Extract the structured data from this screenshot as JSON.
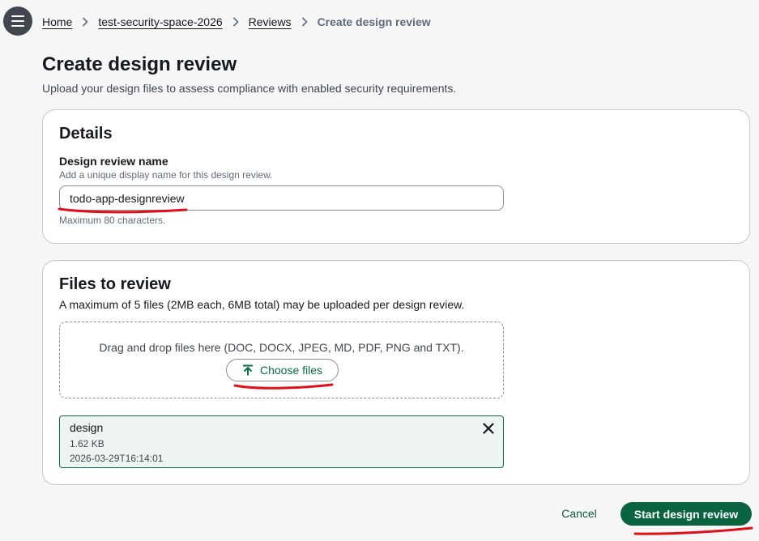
{
  "nav": {
    "menu_icon": "hamburger-menu-icon"
  },
  "breadcrumb": {
    "items": [
      "Home",
      "test-security-space-2026",
      "Reviews"
    ],
    "current": "Create design review",
    "separator_icon": "chevron-right-icon"
  },
  "page": {
    "title": "Create design review",
    "description": "Upload your design files to assess compliance with enabled security requirements."
  },
  "details": {
    "title": "Details",
    "name_label": "Design review name",
    "name_description": "Add a unique display name for this design review.",
    "name_value": "todo-app-designreview",
    "name_constraint": "Maximum 80 characters."
  },
  "files": {
    "title": "Files to review",
    "description": "A maximum of 5 files (2MB each, 6MB total) may be uploaded per design review.",
    "dropzone_text": "Drag and drop files here (DOC, DOCX, JPEG, MD, PDF, PNG and TXT).",
    "choose_label": "Choose files",
    "choose_icon": "upload-arrow-icon",
    "uploaded": [
      {
        "name": "design",
        "size": "1.62 KB",
        "modified": "2026-03-29T16:14:01",
        "remove_icon": "close-icon"
      }
    ]
  },
  "actions": {
    "cancel_label": "Cancel",
    "submit_label": "Start design review"
  },
  "colors": {
    "primary": "#0b6440",
    "accent_text": "#0b6b4a",
    "annotation": "#e0101a",
    "card_border": "#c6c6cd",
    "background": "#f6f6f7"
  }
}
